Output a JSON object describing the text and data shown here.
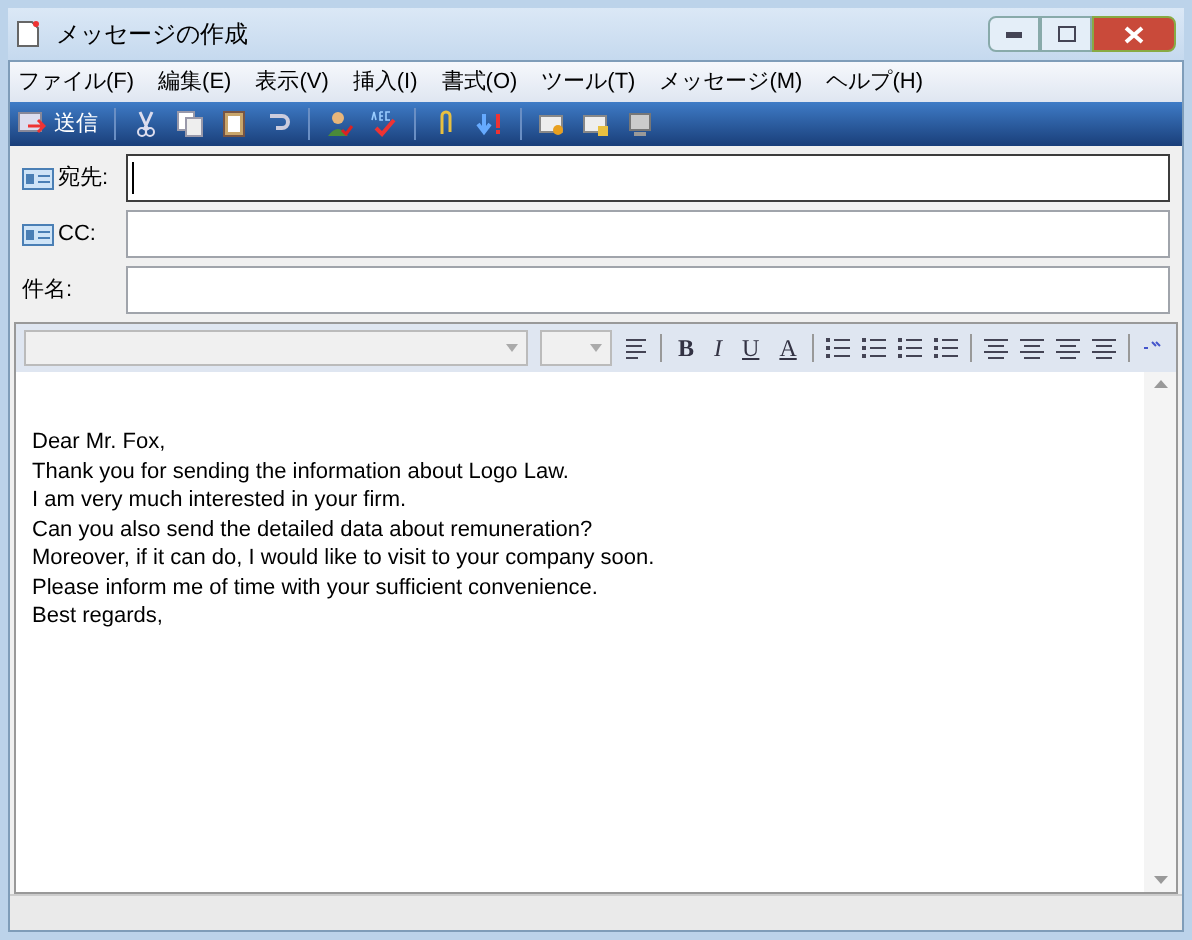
{
  "window": {
    "title": "メッセージの作成"
  },
  "menu": [
    "ファイル(F)",
    "編集(E)",
    "表示(V)",
    "挿入(I)",
    "書式(O)",
    "ツール(T)",
    "メッセージ(M)",
    "ヘルプ(H)"
  ],
  "toolbar": {
    "send": "送信",
    "tools": [
      {
        "kind": "cut"
      },
      {
        "kind": "copy"
      },
      {
        "kind": "paste"
      },
      {
        "kind": "undo"
      },
      {
        "kind": "sep"
      },
      {
        "kind": "check-names"
      },
      {
        "kind": "spelling"
      },
      {
        "kind": "sep"
      },
      {
        "kind": "attach"
      },
      {
        "kind": "priority"
      },
      {
        "kind": "sep"
      },
      {
        "kind": "sign"
      },
      {
        "kind": "encrypt"
      },
      {
        "kind": "offline"
      }
    ]
  },
  "fields": [
    {
      "kind": "address",
      "label": "宛先:",
      "focused": true
    },
    {
      "kind": "address",
      "label": "CC:",
      "focused": false
    },
    {
      "kind": "plain",
      "label": "件名:",
      "focused": false
    }
  ],
  "format_toolbar": {
    "styles": [
      "B",
      "I",
      "U",
      "A"
    ]
  },
  "body": [
    "Dear Mr. Fox,",
    "Thank you for sending the information about Logo Law.",
    "I am very much interested in your firm.",
    "Can you also send the detailed data about remuneration?",
    "Moreover, if it can do, I would like to visit to your company soon.",
    "Please inform me of time with your sufficient convenience.",
    "Best regards,"
  ]
}
